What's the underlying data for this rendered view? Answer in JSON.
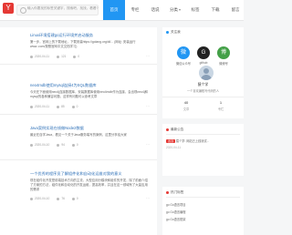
{
  "header": {
    "logo_text": "Y",
    "search_placeholder": "输入你要找的标签关键字，搜索吧，找找，看看?",
    "nav": [
      {
        "label": "首页",
        "active": true
      },
      {
        "label": "专栏",
        "active": false
      },
      {
        "label": "话说",
        "active": false
      },
      {
        "label": "分类",
        "active": false
      },
      {
        "label": "标签",
        "active": false
      },
      {
        "label": "下载",
        "active": false
      },
      {
        "label": "留言",
        "active": false
      }
    ]
  },
  "articles": [
    {
      "title": "Linux环境搭建go运行环境并启动服务",
      "summary": "第一步，官网上的下载地址，下载安装https://golang.org/dl/... (网址: 安装运行 www..com/按照官网中文文档学习)",
      "date": "2020-04-11",
      "views": "121",
      "comments": "0"
    },
    {
      "title": "neo4mdb使用mysql连接4为SQL数据库",
      "summary": "今天在下面使用neo4j连接数据库，安装数据库使用neo4mdb作为连接，会出现neo4j和mysql的各种兼容问题，这样有问题可以参考文章",
      "date": "2020-04-11",
      "views": "85",
      "comments": "0"
    },
    {
      "title": "Java案例实现在线做Node2数据",
      "summary": "最近在自学Java，看见一个关于Java服务端写的案例，这里分享给大家",
      "date": "2020-04-10",
      "views": "94",
      "comments": "0"
    },
    {
      "title": "一个优秀的程序员了解组件化和自动化运维对我的意义",
      "summary": "现在组件化开发是前端技术方向的主流，大型应用分模块和组件的开发，除了前面介绍了方案的方法，组件化和自动化的开发运维，提高效率，并且在这一领域有了大量应用的需求",
      "date": "2020-04-10",
      "views": "76",
      "comments": "0"
    }
  ],
  "sidebar": {
    "follow_title": "关注我",
    "socials": [
      {
        "label": "微信公众号",
        "icon": "wechat-icon",
        "color": "#2196f3",
        "glyph": "微"
      },
      {
        "label": "github",
        "icon": "github-icon",
        "color": "#222222",
        "glyph": "G"
      },
      {
        "label": "微博号",
        "icon": "weibo-icon",
        "color": "#43a047",
        "glyph": "博"
      }
    ],
    "profile_name": "猿个学",
    "profile_desc": "一个喜欢编程写代码的人",
    "stats": [
      {
        "value": "40",
        "label": "文章"
      },
      {
        "value": "1",
        "label": "专栏"
      }
    ],
    "notice_title": "最新公告",
    "notice_badge": "置顶",
    "notice_text": "猿个学: 网站已上线测试...",
    "notice_date": "2020-04-11",
    "hot_title": "热门标签",
    "hot_items": [
      "go  Go语言项目",
      "go  Go语言编程",
      "go  Go语言框架"
    ]
  }
}
